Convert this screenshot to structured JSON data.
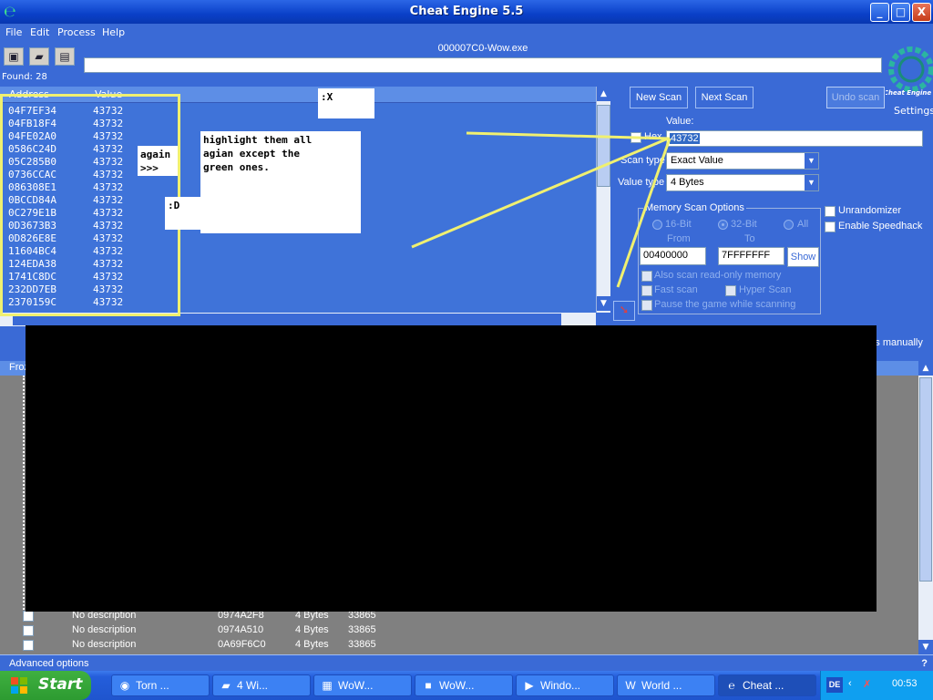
{
  "window": {
    "title": "Cheat Engine 5.5",
    "minimize": "_",
    "maximize": "□",
    "close": "X"
  },
  "menu": [
    "File",
    "Edit",
    "Process",
    "Help"
  ],
  "process": {
    "label": "000007C0-Wow.exe"
  },
  "found": "Found: 28",
  "logo": {
    "text": "Cheat Engine",
    "settings": "Settings"
  },
  "results": {
    "columns": [
      "Address",
      "Value"
    ],
    "rows": [
      {
        "address": "04F7EF34",
        "value": "43732"
      },
      {
        "address": "04FB18F4",
        "value": "43732"
      },
      {
        "address": "04FE02A0",
        "value": "43732"
      },
      {
        "address": "0586C24D",
        "value": "43732"
      },
      {
        "address": "05C285B0",
        "value": "43732"
      },
      {
        "address": "0736CCAC",
        "value": "43732"
      },
      {
        "address": "086308E1",
        "value": "43732"
      },
      {
        "address": "0BCCD84A",
        "value": "43732"
      },
      {
        "address": "0C279E1B",
        "value": "43732"
      },
      {
        "address": "0D3673B3",
        "value": "43732"
      },
      {
        "address": "0D826E8E",
        "value": "43732"
      },
      {
        "address": "11604BC4",
        "value": "43732"
      },
      {
        "address": "124EDA38",
        "value": "43732"
      },
      {
        "address": "1741C8DC",
        "value": "43732"
      },
      {
        "address": "232DD7EB",
        "value": "43732"
      },
      {
        "address": "2370159C",
        "value": "43732"
      }
    ]
  },
  "notes": {
    "x_note": ":X",
    "again_line1": "again",
    "again_line2": ">>>",
    "d_note": ":D",
    "instructions": [
      "highlight them all",
      "agian except the",
      "green ones."
    ]
  },
  "scan": {
    "new_scan": "New Scan",
    "next_scan": "Next Scan",
    "undo_scan": "Undo scan",
    "value_label": "Value:",
    "hex_label": "Hex",
    "value": "43732",
    "scan_type_label": "Scan type",
    "scan_type": "Exact Value",
    "value_type_label": "Value type",
    "value_type": "4 Bytes",
    "options_title": "Memory Scan Options",
    "radio_16": "16-Bit",
    "radio_32": "32-Bit",
    "radio_all": "All",
    "from_label": "From",
    "to_label": "To",
    "from_value": "00400000",
    "to_value": "7FFFFFFF",
    "show": "Show",
    "readonly": "Also scan read-only memory",
    "fast_scan": "Fast scan",
    "hyper_scan": "Hyper Scan",
    "pause": "Pause the game while scanning",
    "unrandomizer": "Unrandomizer",
    "speedhack": "Enable Speedhack"
  },
  "lower": {
    "add_manually": "Add address manually",
    "frozen_header": "Frozen",
    "rows": [
      {
        "description": "No description",
        "address": "0974A2F8",
        "type": "4 Bytes",
        "value": "33865"
      },
      {
        "description": "No description",
        "address": "0974A510",
        "type": "4 Bytes",
        "value": "33865"
      },
      {
        "description": "No description",
        "address": "0A69F6C0",
        "type": "4 Bytes",
        "value": "33865"
      }
    ],
    "advanced_options": "Advanced options",
    "help": "?"
  },
  "taskbar": {
    "start": "Start",
    "tasks": [
      {
        "label": "Torn ...",
        "icon": "firefox-icon",
        "active": false
      },
      {
        "label": "4 Wi...",
        "icon": "folder-icon",
        "active": false
      },
      {
        "label": "WoW...",
        "icon": "winrar-icon",
        "active": false
      },
      {
        "label": "WoW...",
        "icon": "app-icon",
        "active": false
      },
      {
        "label": "Windo...",
        "icon": "media-player-icon",
        "active": false
      },
      {
        "label": "World ...",
        "icon": "wow-icon",
        "active": false
      },
      {
        "label": "Cheat ...",
        "icon": "cheat-engine-icon",
        "active": true
      }
    ],
    "language": "DE",
    "clock": "00:53"
  },
  "colors": {
    "window_blue": "#3a6ad6",
    "annotation_yellow": "#f0f070",
    "taskbar_start_green": "#3fb040"
  }
}
